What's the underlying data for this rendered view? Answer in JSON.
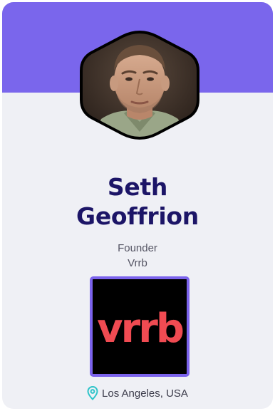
{
  "profile": {
    "first_name": "Seth",
    "last_name": "Geoffrion",
    "title": "Founder",
    "company": "Vrrb",
    "location": "Los Angeles, USA",
    "avatar_icon": "portrait-photo",
    "location_icon": "map-pin-icon"
  },
  "company_logo": {
    "wordmark": "vrrb",
    "background_color": "#000000",
    "text_color": "#f04b52",
    "border_color": "#7b63ec"
  },
  "colors": {
    "banner": "#7a66ec",
    "card_background": "#eff0f5",
    "name_text": "#1c1567",
    "pin_icon": "#2ec4c9"
  }
}
